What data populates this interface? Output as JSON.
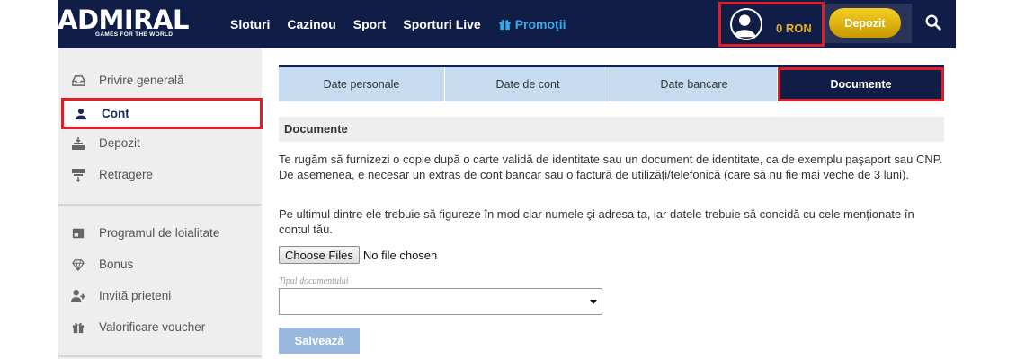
{
  "brand": {
    "name": "ADMIRAL",
    "tagline": "GAMES FOR THE WORLD"
  },
  "nav": {
    "items": [
      {
        "label": "Sloturi"
      },
      {
        "label": "Cazinou"
      },
      {
        "label": "Sport"
      },
      {
        "label": "Sporturi Live"
      },
      {
        "label": "Promoţii",
        "icon": "gift-icon"
      }
    ]
  },
  "account": {
    "balance": "0 RON",
    "deposit_label": "Depozit",
    "avatar_icon": "user-avatar-icon",
    "search_icon": "search-icon"
  },
  "sidebar": {
    "items": [
      {
        "label": "Privire generală",
        "icon": "inbox-icon"
      },
      {
        "label": "Cont",
        "icon": "user-icon",
        "active": true
      },
      {
        "label": "Depozit",
        "icon": "deposit-icon"
      },
      {
        "label": "Retragere",
        "icon": "withdraw-icon"
      },
      {
        "label": "Programul de loialitate",
        "icon": "id-card-icon"
      },
      {
        "label": "Bonus",
        "icon": "diamond-icon"
      },
      {
        "label": "Invită prieteni",
        "icon": "add-user-icon"
      },
      {
        "label": "Valorificare voucher",
        "icon": "gift-icon"
      }
    ]
  },
  "tabs": [
    {
      "label": "Date personale"
    },
    {
      "label": "Date de cont"
    },
    {
      "label": "Date bancare"
    },
    {
      "label": "Documente",
      "active": true
    }
  ],
  "documents": {
    "header": "Documente",
    "paragraph1": "Te rugăm să furnizezi o copie după o carte validă de identitate sau un document de identitate, ca de exemplu paşaport sau CNP. De asemenea, e necesar un extras de cont bancar sau o factură de utilizăţi/telefonică (care să nu fie mai veche de 3 luni).",
    "paragraph2": "Pe ultimul dintre ele trebuie să figureze în mod clar numele şi adresa ta, iar datele trebuie să concidă cu cele menţionate în contul tău.",
    "file_button": "Choose Files",
    "file_status": "No file chosen",
    "doc_type_label": "Tipul documentului",
    "doc_type_value": "",
    "save_label": "Salvează"
  },
  "colors": {
    "navy": "#0f1d47",
    "highlight_red": "#e11d2a",
    "gold": "#e3b020",
    "tab_blue": "#c7dcf1",
    "promo_blue": "#3aa7e8"
  }
}
